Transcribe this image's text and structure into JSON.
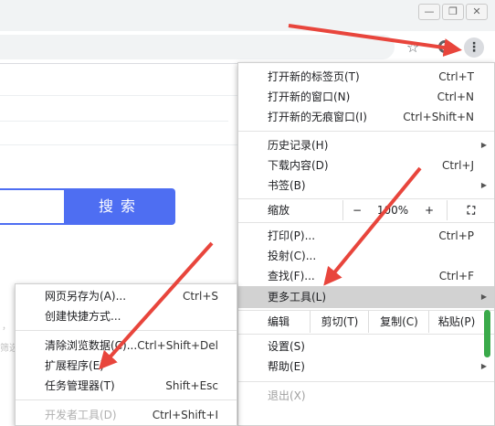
{
  "window": {
    "minimize_glyph": "—",
    "restore_glyph": "❐",
    "close_glyph": "✕"
  },
  "toolbar": {
    "star_glyph": "☆",
    "menu_glyph": "⋮"
  },
  "page": {
    "search_button": "搜索",
    "faded_left_1": "，",
    "faded_left_2": "筛选"
  },
  "menu": {
    "new_tab": {
      "label": "打开新的标签页(T)",
      "shortcut": "Ctrl+T"
    },
    "new_window": {
      "label": "打开新的窗口(N)",
      "shortcut": "Ctrl+N"
    },
    "new_incognito": {
      "label": "打开新的无痕窗口(I)",
      "shortcut": "Ctrl+Shift+N"
    },
    "history": {
      "label": "历史记录(H)"
    },
    "downloads": {
      "label": "下载内容(D)",
      "shortcut": "Ctrl+J"
    },
    "bookmarks": {
      "label": "书签(B)"
    },
    "zoom": {
      "label": "缩放",
      "minus": "−",
      "value": "100%",
      "plus": "+",
      "fullscreen_glyph": "⛶"
    },
    "print": {
      "label": "打印(P)...",
      "shortcut": "Ctrl+P"
    },
    "cast": {
      "label": "投射(C)..."
    },
    "find": {
      "label": "查找(F)...",
      "shortcut": "Ctrl+F"
    },
    "more_tools": {
      "label": "更多工具(L)"
    },
    "edit": {
      "label": "编辑",
      "cut": "剪切(T)",
      "copy": "复制(C)",
      "paste": "粘贴(P)"
    },
    "settings": {
      "label": "设置(S)"
    },
    "help": {
      "label": "帮助(E)"
    },
    "exit": {
      "label": "退出(X)"
    },
    "arrow_glyph": "▶"
  },
  "submenu": {
    "save_page": {
      "label": "网页另存为(A)...",
      "shortcut": "Ctrl+S"
    },
    "create_shortcut": {
      "label": "创建快捷方式..."
    },
    "clear_data": {
      "label": "清除浏览数据(C)...",
      "shortcut": "Ctrl+Shift+Del"
    },
    "extensions": {
      "label": "扩展程序(E)"
    },
    "task_manager": {
      "label": "任务管理器(T)",
      "shortcut": "Shift+Esc"
    },
    "dev_tools": {
      "label": "开发者工具(D)",
      "shortcut": "Ctrl+Shift+I"
    }
  },
  "colors": {
    "arrow": "#e8453c",
    "search_blue": "#4e6ef2",
    "highlight": "#d2d2d2"
  }
}
